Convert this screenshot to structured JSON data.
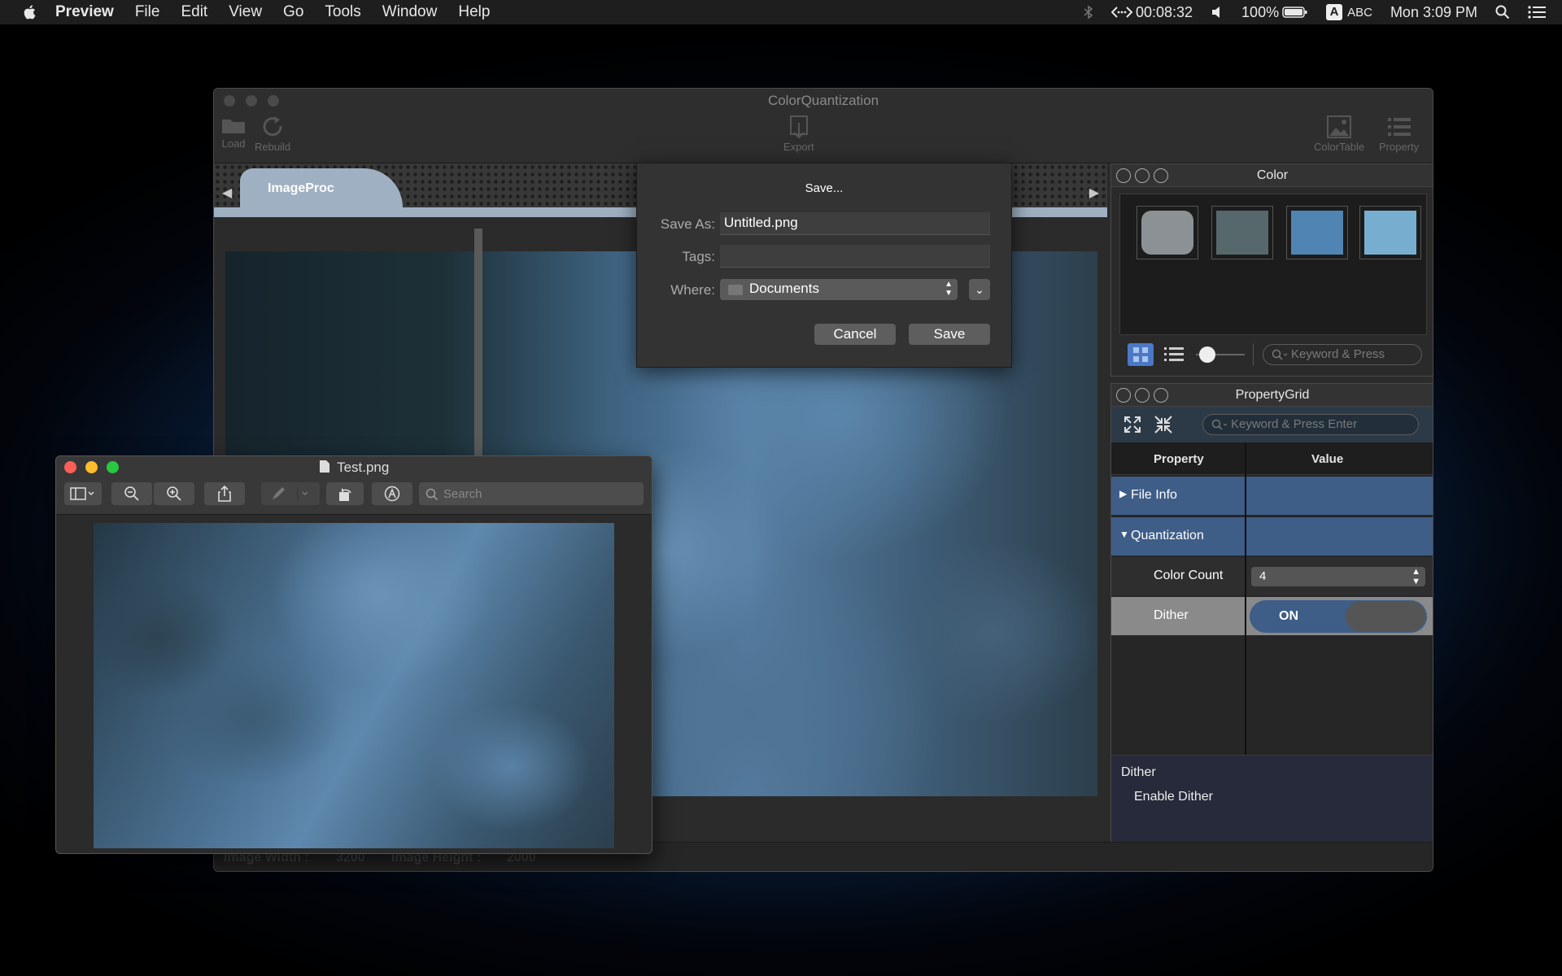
{
  "menubar": {
    "app": "Preview",
    "items": [
      "File",
      "Edit",
      "View",
      "Go",
      "Tools",
      "Window",
      "Help"
    ],
    "timer": "00:08:32",
    "battery": "100%",
    "input_source": "ABC",
    "input_badge": "A",
    "clock": "Mon 3:09 PM"
  },
  "main_window": {
    "title": "ColorQuantization",
    "toolbar": {
      "load": "Load",
      "rebuild": "Rebuild",
      "export": "Export",
      "color_table": "ColorTable",
      "property": "Property"
    },
    "tab": "ImageProc",
    "status": {
      "width_label": "Image Width :",
      "width_value": "3200",
      "height_label": "Image Height :",
      "height_value": "2000"
    }
  },
  "color_panel": {
    "title": "Color",
    "swatches": [
      "#8c9195",
      "#56686c",
      "#4f84b3",
      "#77aed0"
    ],
    "search_placeholder": "Keyword & Press",
    "slider_level": 0.1
  },
  "property_grid": {
    "title": "PropertyGrid",
    "search_placeholder": "Keyword & Press Enter",
    "col_property": "Property",
    "col_value": "Value",
    "rows": {
      "file_info": "File Info",
      "quantization": "Quantization",
      "color_count": "Color Count",
      "color_count_value": "4",
      "dither": "Dither",
      "dither_value": "ON"
    },
    "desc_title": "Dither",
    "desc_text": "Enable Dither"
  },
  "save_dialog": {
    "title": "Save...",
    "save_as_label": "Save As:",
    "save_as_value": "Untitled.png",
    "tags_label": "Tags:",
    "tags_value": "",
    "where_label": "Where:",
    "where_value": "Documents",
    "cancel": "Cancel",
    "save": "Save"
  },
  "preview_window": {
    "title": "Test.png",
    "search_placeholder": "Search"
  }
}
